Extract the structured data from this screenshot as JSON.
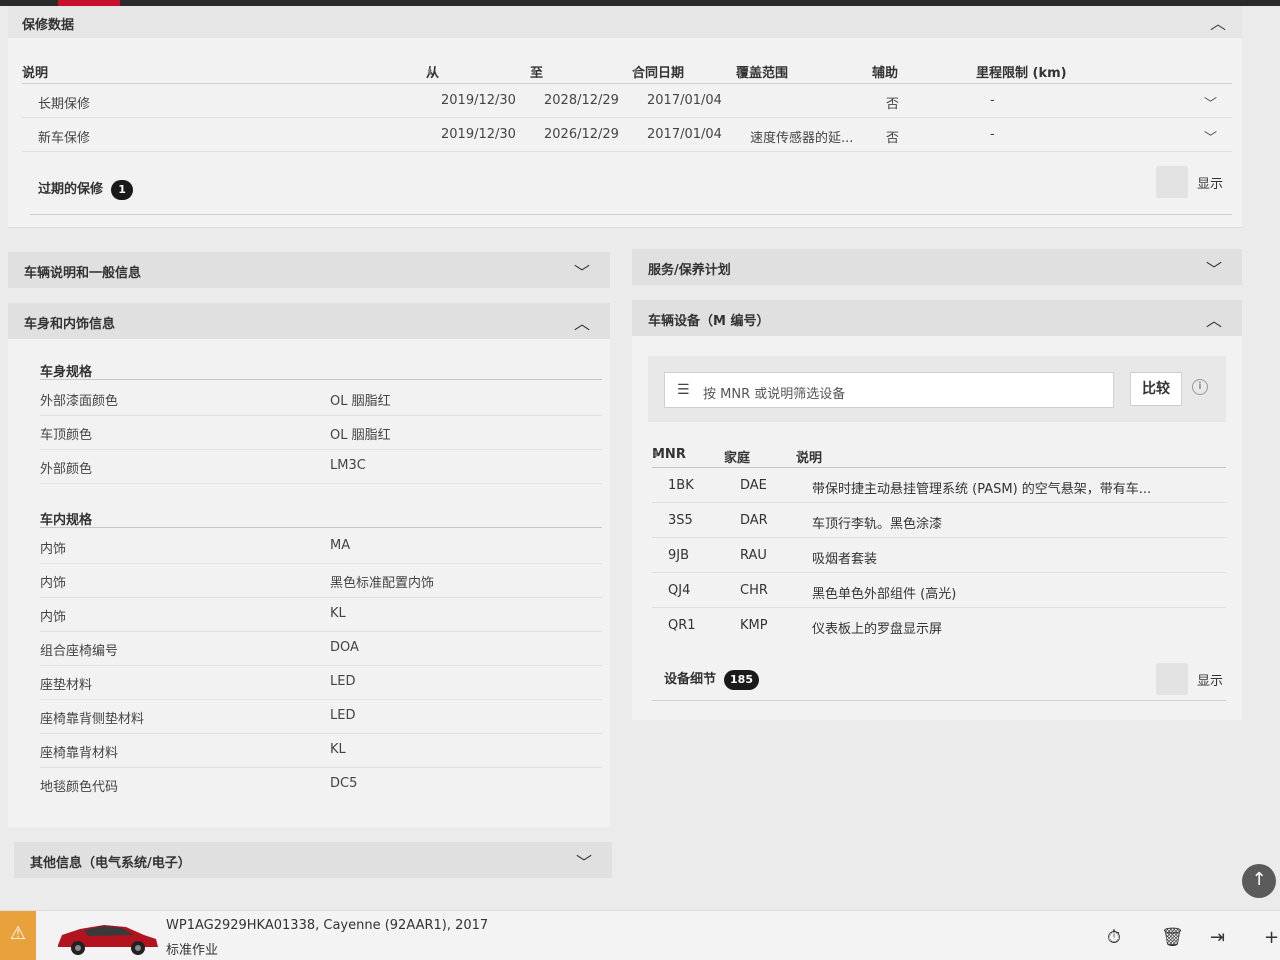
{
  "warranty": {
    "title": "保修数据",
    "columns": [
      "说明",
      "从",
      "至",
      "合同日期",
      "覆盖范围",
      "辅助",
      "里程限制 (km)"
    ],
    "rows": [
      {
        "desc": "长期保修",
        "from": "2019/12/30",
        "to": "2028/12/29",
        "contract": "2017/01/04",
        "coverage": "",
        "aux": "否",
        "mileage": "-"
      },
      {
        "desc": "新车保修",
        "from": "2019/12/30",
        "to": "2026/12/29",
        "contract": "2017/01/04",
        "coverage": "速度传感器的延...",
        "aux": "否",
        "mileage": "-"
      }
    ],
    "expired_label": "过期的保修",
    "expired_count": "1",
    "show_label": "显示"
  },
  "left_panels": {
    "general_title": "车辆说明和一般信息",
    "body_title": "车身和内饰信息",
    "other_title": "其他信息（电气系统/电子）"
  },
  "body_specs": {
    "exterior_header": "车身规格",
    "exterior": [
      {
        "k": "外部漆面颜色",
        "v": "OL 胭脂红"
      },
      {
        "k": "车顶颜色",
        "v": "OL 胭脂红"
      },
      {
        "k": "外部颜色",
        "v": "LM3C"
      }
    ],
    "interior_header": "车内规格",
    "interior": [
      {
        "k": "内饰",
        "v": "MA"
      },
      {
        "k": "内饰",
        "v": "黑色标准配置内饰"
      },
      {
        "k": "内饰",
        "v": "KL"
      },
      {
        "k": "组合座椅编号",
        "v": "DOA"
      },
      {
        "k": "座垫材料",
        "v": "LED"
      },
      {
        "k": "座椅靠背侧垫材料",
        "v": "LED"
      },
      {
        "k": "座椅靠背材料",
        "v": "KL"
      },
      {
        "k": "地毯颜色代码",
        "v": "DC5"
      }
    ]
  },
  "right_panels": {
    "service_title": "服务/保养计划",
    "equipment_title": "车辆设备（M 编号）"
  },
  "equipment": {
    "filter_placeholder": "按 MNR 或说明筛选设备",
    "compare_label": "比较",
    "columns": [
      "MNR",
      "家庭",
      "说明"
    ],
    "rows": [
      {
        "mnr": "1BK",
        "family": "DAE",
        "desc": "带保时捷主动悬挂管理系统 (PASM) 的空气悬架，带有车..."
      },
      {
        "mnr": "3S5",
        "family": "DAR",
        "desc": "车顶行李轨。黑色涂漆"
      },
      {
        "mnr": "9JB",
        "family": "RAU",
        "desc": "吸烟者套装"
      },
      {
        "mnr": "QJ4",
        "family": "CHR",
        "desc": "黑色单色外部组件 (高光)"
      },
      {
        "mnr": "QR1",
        "family": "KMP",
        "desc": "仪表板上的罗盘显示屏"
      }
    ],
    "detail_label": "设备细节",
    "detail_count": "185",
    "show_label": "显示"
  },
  "bottom_bar": {
    "vehicle": "WP1AG2929HKA01338, Cayenne (92AAR1), 2017",
    "job": "标准作业"
  },
  "icons": {
    "sort": "sort-icon",
    "chevron_down": "chevron-down-icon",
    "chevron_up": "chevron-up-icon",
    "filter": "filter-icon",
    "info": "info-icon",
    "warning": "warning-icon",
    "timer": "timer-icon",
    "trash": "trash-icon",
    "transfer": "transfer-icon",
    "plus": "plus-icon",
    "arrow_up": "arrow-up-icon"
  },
  "colors": {
    "accent_red": "#c8102e",
    "warning": "#e9a23b",
    "badge": "#1a1a1a"
  }
}
